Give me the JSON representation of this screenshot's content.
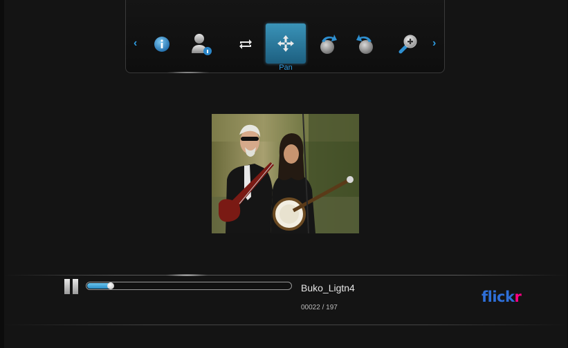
{
  "toolbar": {
    "prev_arrow": "‹",
    "next_arrow": "›",
    "selected_label": "Pan",
    "tools": [
      {
        "icon": "info-icon"
      },
      {
        "icon": "user-info-icon"
      },
      {
        "icon": "repeat-icon"
      },
      {
        "icon": "pan-icon",
        "selected": true
      },
      {
        "icon": "rotate-left-icon"
      },
      {
        "icon": "rotate-right-icon"
      },
      {
        "icon": "zoom-in-icon"
      }
    ]
  },
  "photo": {
    "description_icon": "photo-concert-icon"
  },
  "playback": {
    "state_icon": "pause-icon",
    "progress": 0.12,
    "file_name": "Buko_Ligtn4",
    "counter": "00022 / 197"
  },
  "brand": {
    "logo_part1": "flick",
    "logo_part2": "r",
    "colors": {
      "accent": "#2e9be0",
      "flickr_blue": "#2e6fd8",
      "flickr_pink": "#ff0084"
    }
  }
}
